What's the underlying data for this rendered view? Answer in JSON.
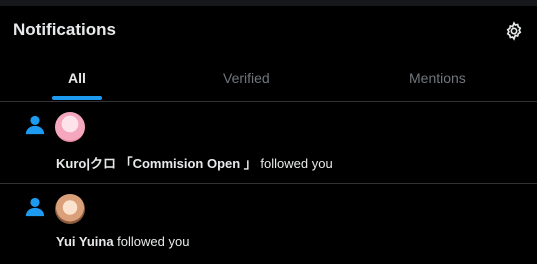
{
  "header": {
    "title": "Notifications",
    "settings_icon": "gear-icon"
  },
  "tabs": [
    {
      "label": "All",
      "active": true
    },
    {
      "label": "Verified",
      "active": false
    },
    {
      "label": "Mentions",
      "active": false
    }
  ],
  "notifications": [
    {
      "type_icon": "person-icon",
      "user_name": "Kuro|クロ 「Commision Open 」",
      "action": " followed you"
    },
    {
      "type_icon": "person-icon",
      "user_name": "Yui Yuina",
      "action": " followed you"
    }
  ],
  "colors": {
    "accent": "#1d9bf0",
    "background": "#000000",
    "text": "#e7e9ea",
    "muted": "#71767b",
    "divider": "#2f3336"
  }
}
